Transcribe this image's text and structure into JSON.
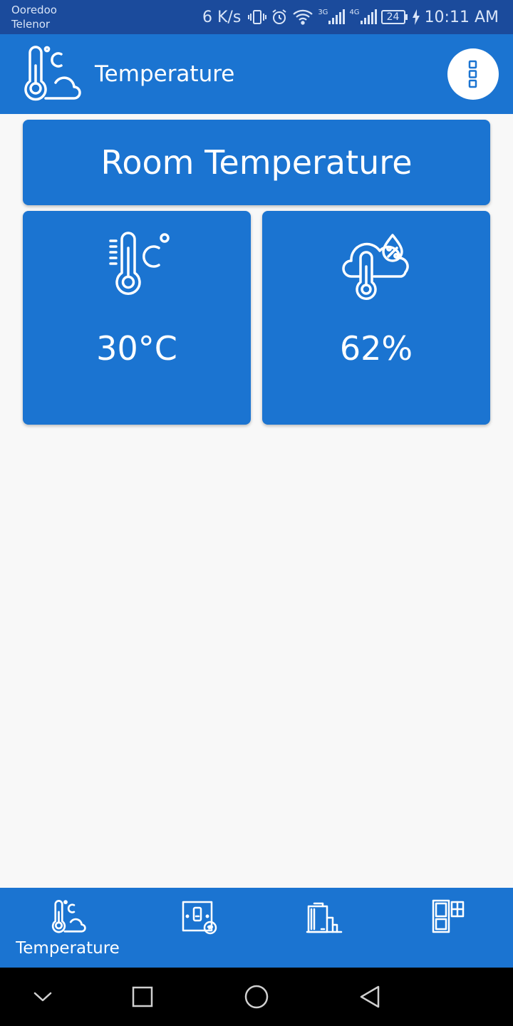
{
  "status_bar": {
    "carrier_1": "Ooredoo",
    "carrier_2": "Telenor",
    "net_speed": "6 K/s",
    "network_1_label": "3G",
    "network_2_label": "4G",
    "battery_level": "24",
    "time": "10:11 AM",
    "icons": [
      "vibrate-icon",
      "alarm-icon",
      "wifi-icon",
      "signal-3g-icon",
      "signal-4g-icon",
      "battery-icon",
      "charging-icon"
    ]
  },
  "app_bar": {
    "title": "Temperature",
    "logo_icon": "thermometer-cloud-icon",
    "menu_icon": "more-vertical-icon"
  },
  "main": {
    "header_title": "Room Temperature",
    "sensors": [
      {
        "icon": "thermometer-celsius-icon",
        "value": "30°C"
      },
      {
        "icon": "humidity-cloud-icon",
        "value": "62%"
      }
    ]
  },
  "bottom_nav": {
    "items": [
      {
        "icon": "thermometer-cloud-icon",
        "label": "Temperature",
        "active": true
      },
      {
        "icon": "smart-switch-icon",
        "label": ""
      },
      {
        "icon": "room-appliance-icon",
        "label": ""
      },
      {
        "icon": "door-window-icon",
        "label": ""
      }
    ]
  },
  "system_nav": [
    "collapse-icon",
    "recents-icon",
    "home-icon",
    "back-icon"
  ],
  "colors": {
    "status_bar": "#1b4b9c",
    "primary": "#1b74d1",
    "background": "#f8f8f8",
    "system_nav": "#000000"
  }
}
